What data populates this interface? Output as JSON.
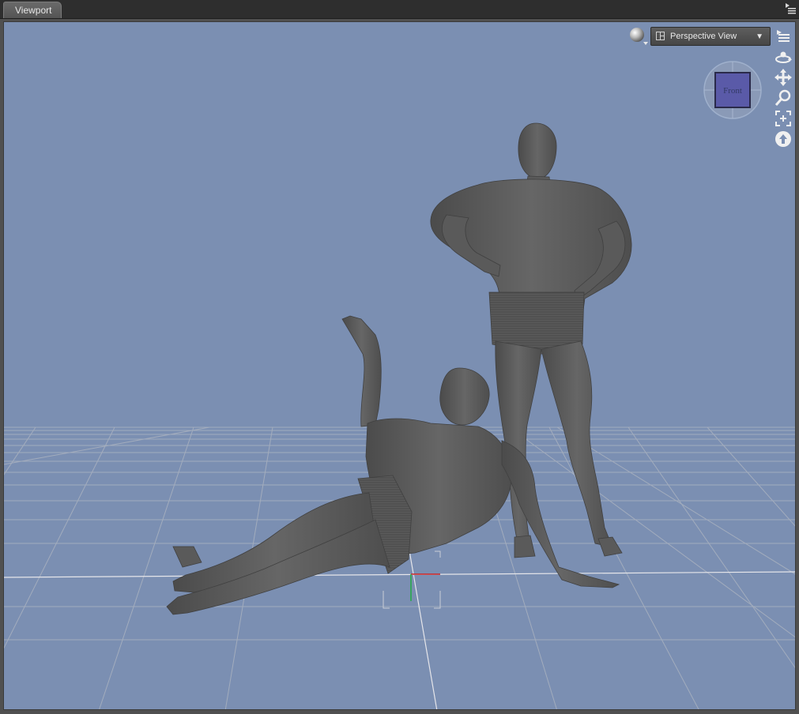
{
  "panel": {
    "tab_label": "Viewport"
  },
  "toolbar": {
    "view_label": "Perspective View"
  },
  "view_cube": {
    "face_label": "Front"
  },
  "icons": {
    "panel_menu": "panel-options-icon",
    "draw_style": "draw-style-sphere-icon",
    "view_layout": "view-layout-icon",
    "dropdown": "chevron-down-icon",
    "menu": "viewport-menu-icon",
    "orbit": "orbit-icon",
    "pan": "pan-icon",
    "zoom": "zoom-icon",
    "frame": "frame-selection-icon",
    "bank": "bank-icon"
  },
  "colors": {
    "background": "#7b8fb2",
    "grid": "#a7b0bf",
    "x_axis": "#cc2222",
    "y_axis": "#22aa44",
    "figure": "#595959",
    "cube_face": "#5a5aa8"
  }
}
